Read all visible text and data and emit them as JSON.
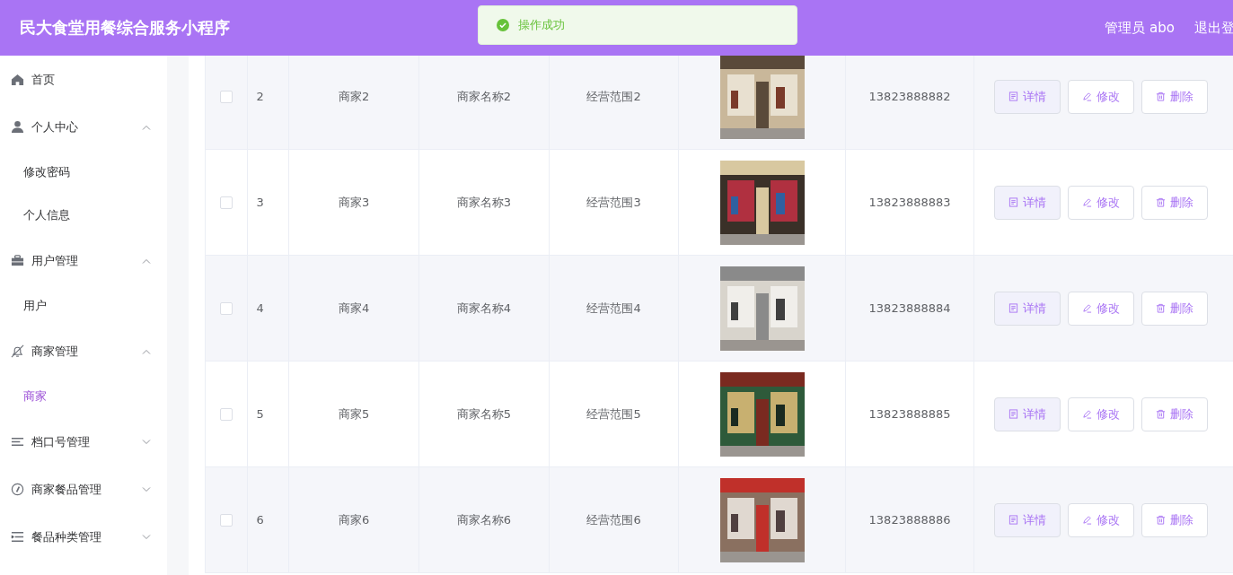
{
  "header": {
    "title": "民大食堂用餐综合服务小程序",
    "user": "管理员 abo",
    "logout": "退出登"
  },
  "toast": {
    "kind": "success",
    "message": "操作成功"
  },
  "sidebar": {
    "items": [
      {
        "label": "首页"
      },
      {
        "label": "个人中心",
        "expanded": true,
        "children": [
          {
            "label": "修改密码",
            "selected": false
          },
          {
            "label": "个人信息",
            "selected": false
          }
        ]
      },
      {
        "label": "用户管理",
        "expanded": true,
        "children": [
          {
            "label": "用户",
            "selected": false
          }
        ]
      },
      {
        "label": "商家管理",
        "expanded": true,
        "children": [
          {
            "label": "商家",
            "selected": true
          }
        ]
      },
      {
        "label": "档口号管理",
        "expanded": false
      },
      {
        "label": "商家餐品管理",
        "expanded": false
      },
      {
        "label": "餐品种类管理",
        "expanded": false
      }
    ]
  },
  "table": {
    "rows": [
      {
        "checked": false,
        "index": "2",
        "merchant": "商家2",
        "name": "商家名称2",
        "scope": "经营范围2",
        "phone": "13823888882",
        "actions": [
          {
            "kind": "detail",
            "label": "详情"
          },
          {
            "kind": "edit",
            "label": "修改"
          },
          {
            "kind": "delete",
            "label": "删除"
          }
        ]
      },
      {
        "checked": false,
        "index": "3",
        "merchant": "商家3",
        "name": "商家名称3",
        "scope": "经营范围3",
        "phone": "13823888883",
        "actions": [
          {
            "kind": "detail",
            "label": "详情"
          },
          {
            "kind": "edit",
            "label": "修改"
          },
          {
            "kind": "delete",
            "label": "删除"
          }
        ]
      },
      {
        "checked": false,
        "index": "4",
        "merchant": "商家4",
        "name": "商家名称4",
        "scope": "经营范围4",
        "phone": "13823888884",
        "actions": [
          {
            "kind": "detail",
            "label": "详情"
          },
          {
            "kind": "edit",
            "label": "修改"
          },
          {
            "kind": "delete",
            "label": "删除"
          }
        ]
      },
      {
        "checked": false,
        "index": "5",
        "merchant": "商家5",
        "name": "商家名称5",
        "scope": "经营范围5",
        "phone": "13823888885",
        "actions": [
          {
            "kind": "detail",
            "label": "详情"
          },
          {
            "kind": "edit",
            "label": "修改"
          },
          {
            "kind": "delete",
            "label": "删除"
          }
        ]
      },
      {
        "checked": false,
        "index": "6",
        "merchant": "商家6",
        "name": "商家名称6",
        "scope": "经营范围6",
        "phone": "13823888886",
        "actions": [
          {
            "kind": "detail",
            "label": "详情"
          },
          {
            "kind": "edit",
            "label": "修改"
          },
          {
            "kind": "delete",
            "label": "删除"
          }
        ]
      }
    ]
  }
}
